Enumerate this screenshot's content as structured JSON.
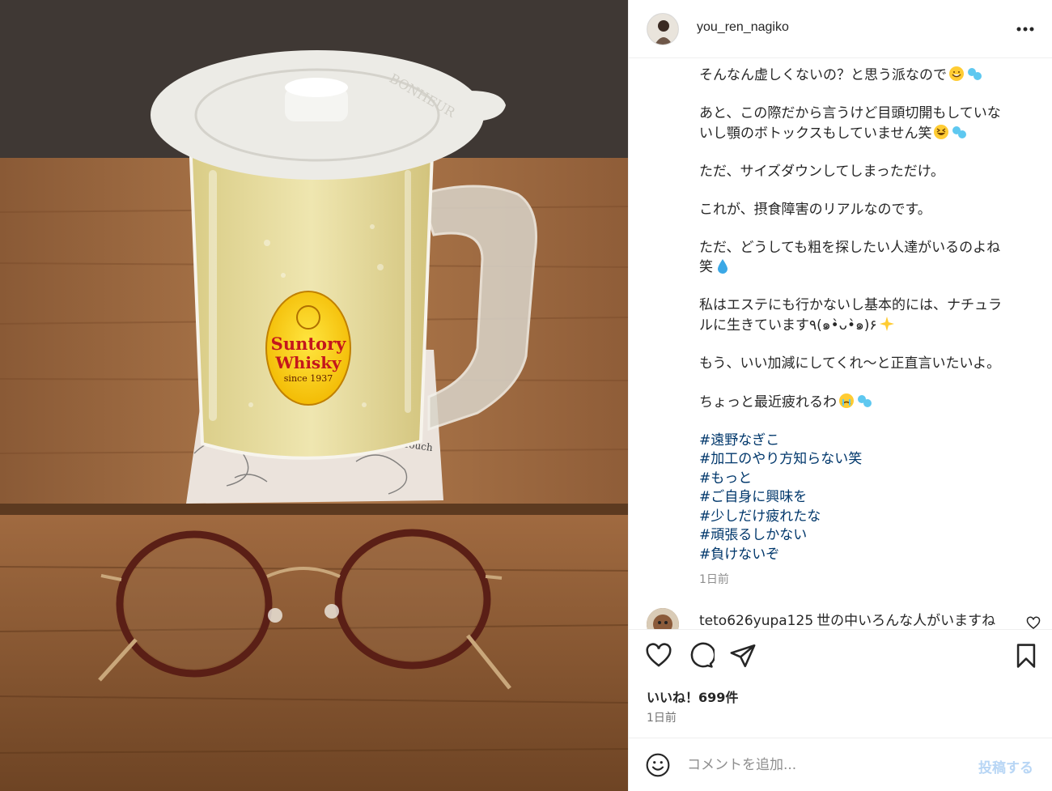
{
  "post": {
    "username": "you_ren_nagiko",
    "caption": [
      "そんなん虚しくないの？と思う派なので",
      "あと、この際だから言うけど目頭切開もしていな\nいし顎のボトックスもしていません笑",
      "ただ、サイズダウンしてしまっただけ。",
      "これが、摂食障害のリアルなのです。",
      "ただ、どうしても粗を探したい人達がいるのよね\n笑",
      "私はエステにも行かないし基本的には、ナチュラ\nルに生きています٩(๑•̀ᴗ•̀๑)۶",
      "もう、いい加減にしてくれ〜と正直言いたいよ。",
      "ちょっと最近疲れるわ"
    ],
    "hashtags": [
      "#遠野なぎこ",
      "#加工のやり方知らない笑",
      "#もっと",
      "#ご自身に興味を",
      "#少しだけ疲れたな",
      "#頑張るしかない",
      "#負けないぞ"
    ],
    "caption_time": "1日前",
    "comment": {
      "user": "teto626yupa125",
      "text": "世の中いろんな人がいますね"
    },
    "likes": "いいね！699件",
    "time": "1日前",
    "comment_placeholder": "コメントを追加...",
    "post_button": "投稿する"
  },
  "photo": {
    "mug_label_line1": "Suntory",
    "mug_label_line2": "Whisky",
    "mug_label_line3": "since 1937",
    "lid_text": "BONHEUR",
    "coaster_text": "Touch"
  },
  "icons": {
    "more": "more-horizontal-icon",
    "like": "heart-icon",
    "comment": "comment-bubble-icon",
    "share": "paper-plane-icon",
    "save": "bookmark-icon",
    "emoji": "smiley-icon"
  },
  "colors": {
    "hashtag": "#00376b",
    "post_disabled": "#b8d6f5",
    "muted": "#8e8e8e"
  }
}
